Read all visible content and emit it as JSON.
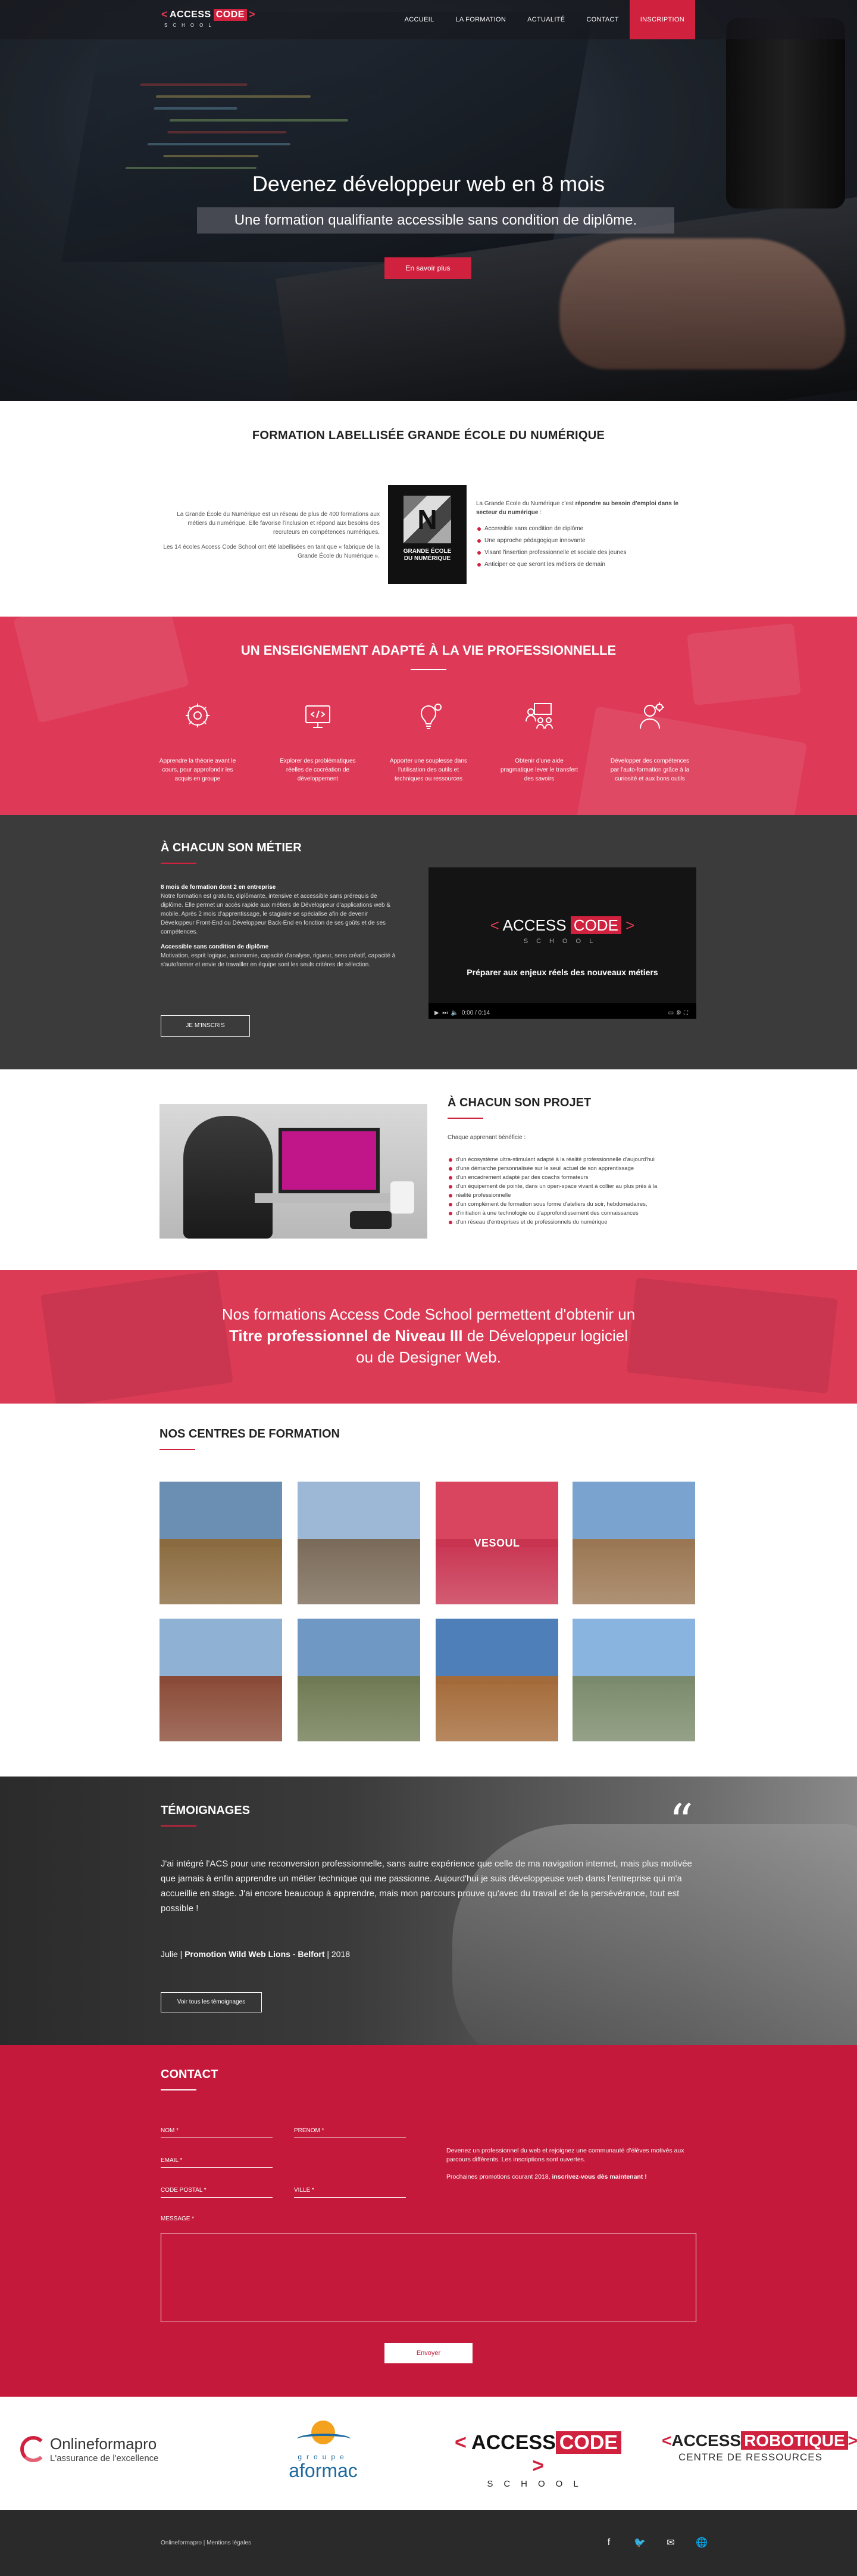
{
  "nav": {
    "logo_main": "ACCESS",
    "logo_code": "CODE",
    "logo_sub": "SCHOOL",
    "items": [
      {
        "label": "ACCUEIL"
      },
      {
        "label": "LA FORMATION"
      },
      {
        "label": "ACTUALITÉ"
      },
      {
        "label": "CONTACT"
      },
      {
        "label": "INSCRIPTION"
      }
    ]
  },
  "hero": {
    "title": "Devenez développeur web en 8 mois",
    "subtitle": "Une formation qualifiante accessible sans condition de diplôme.",
    "cta": "En savoir plus"
  },
  "label": {
    "title": "FORMATION LABELLISÉE GRANDE ÉCOLE DU NUMÉRIQUE",
    "left_p1": "La Grande École du Numérique est un réseau de plus de 400 formations aux métiers du numérique. Elle favorise l'inclusion et répond aux besoins des recruteurs en compétences numériques.",
    "left_p2": "Les 14 écoles Access Code School ont été labellisées en tant que « fabrique de la Grande École du Numérique ».",
    "logo_letter": "N",
    "logo_text_1": "GRANDE ÉCOLE",
    "logo_text_2": "DU NUMÉRIQUE",
    "right_intro_a": "La Grande École du Numérique c'est ",
    "right_intro_b": "répondre au besoin d'emploi dans le secteur du numérique",
    "right_intro_c": " :",
    "bullets": [
      "Accessible sans condition de diplôme",
      "Une approche pédagogique innovante",
      "Visant l'insertion professionnelle et sociale des jeunes",
      "Anticiper ce que seront les métiers de demain"
    ]
  },
  "enseignement": {
    "title": "UN ENSEIGNEMENT ADAPTÉ À LA VIE PROFESSIONNELLE",
    "items": [
      {
        "icon": "brain-gear-icon",
        "text": "Apprendre la théorie avant le cours, pour approfondir les acquis en groupe"
      },
      {
        "icon": "code-screen-icon",
        "text": "Explorer des problématiques réelles de cocréation de développement"
      },
      {
        "icon": "bulb-gear-icon",
        "text": "Apporter une souplesse dans l'utilisation des outils et techniques ou ressources"
      },
      {
        "icon": "team-board-icon",
        "text": "Obtenir d'une aide pragmatique lever le transfert des savoirs"
      },
      {
        "icon": "person-gear-icon",
        "text": "Développer des compétences par l'auto-formation grâce à la curiosité et aux bons outils"
      }
    ]
  },
  "metier": {
    "title": "À CHACUN SON MÉTIER",
    "p1_title": "8 mois de formation dont 2 en entreprise",
    "p1": "Notre formation est gratuite, diplômante, intensive et accessible sans prérequis de diplôme. Elle permet un accès rapide aux métiers de Développeur d'applications web & mobile. Après 2 mois d'apprentissage, le stagiaire se spécialise afin de devenir Développeur Front-End ou Développeur Back-End en fonction de ses goûts et de ses compétences.",
    "p2_title": "Accessible sans condition de diplôme",
    "p2": "Motivation, esprit logique, autonomie, capacité d'analyse, rigueur, sens créatif, capacité à s'autoformer et envie de travailler en équipe sont les seuls critères de sélection.",
    "button": "JE M'INSCRIS",
    "video": {
      "logo_main": "ACCESS",
      "logo_code": "CODE",
      "logo_sub": "SCHOOL",
      "title": "Préparer aux enjeux réels des nouveaux métiers",
      "time": "0:00 / 0:14",
      "progress": 0.04
    }
  },
  "projet": {
    "title": "À CHACUN SON PROJET",
    "intro": "Chaque apprenant bénéficie :",
    "bullets": [
      "d'un écosystème ultra-stimulant adapté à la réalité professionnelle d'aujourd'hui",
      "d'une démarche personnalisée sur le seuil actuel de son apprentissage",
      "d'un encadrement adapté par des coachs formateurs",
      "d'un équipement de pointe, dans un open-space vivant à collier au plus près à la",
      "réalité professionnelle",
      "d'un complément de formation sous forme d'ateliers du soir, hebdomadaires,",
      "d'initiation à une technologie ou d'approfondissement des connaissances",
      "d'un réseau d'entreprises et de professionnels du numérique"
    ]
  },
  "banner": {
    "line1": "Nos formations Access Code School permettent d'obtenir un",
    "line2_bold": "Titre professionnel de Niveau III",
    "line2_rest": " de Développeur logiciel",
    "line3": "ou de Designer Web."
  },
  "centres": {
    "title": "NOS CENTRES DE FORMATION",
    "tiles": [
      {
        "label": "",
        "sky": "#6b8fb3",
        "ground": "#8a6a3e"
      },
      {
        "label": "",
        "sky": "#9db8d6",
        "ground": "#7a6a58"
      },
      {
        "label": "VESOUL",
        "sky": "#d9455f",
        "ground": "#c83350"
      },
      {
        "label": "",
        "sky": "#7aa3cf",
        "ground": "#9a7652"
      },
      {
        "label": "",
        "sky": "#8fb2d4",
        "ground": "#8a4a36"
      },
      {
        "label": "",
        "sky": "#6f98c4",
        "ground": "#6f7a52"
      },
      {
        "label": "",
        "sky": "#4f7fb8",
        "ground": "#a46a38"
      },
      {
        "label": "",
        "sky": "#8ab4e0",
        "ground": "#7a8a6a"
      }
    ]
  },
  "temoignages": {
    "title": "TÉMOIGNAGES",
    "quote": "J'ai intégré l'ACS pour une reconversion professionnelle, sans autre expérience que celle de ma navigation internet, mais plus motivée que jamais à enfin apprendre un métier technique qui me passionne. Aujourd'hui je suis développeuse web dans l'entreprise qui m'a accueillie en stage. J'ai encore beaucoup à apprendre, mais mon parcours prouve qu'avec du travail et de la persévérance, tout est possible !",
    "author": "Julie",
    "promo": "Promotion Wild Web Lions - Belfort",
    "year": "2018",
    "button": "Voir tous les témoignages"
  },
  "contact": {
    "title": "CONTACT",
    "fields": {
      "nom": "NOM *",
      "prenom": "PRÉNOM *",
      "email": "EMAIL *",
      "cp": "CODE POSTAL *",
      "ville": "VILLE *"
    },
    "message_label": "MESSAGE *",
    "info_p1": "Devenez un professionnel du web et rejoignez une communauté d'élèves motivés aux parcours différents. Les inscriptions sont ouvertes.",
    "info_p2_a": "Prochaines promotions courant 2018, ",
    "info_p2_b": "inscrivez-vous dès maintenant !",
    "send": "Envoyer"
  },
  "partners": {
    "p1_name": "Onlineformapro",
    "p1_tag": "L'assurance de l'excellence",
    "p2_top": "groupe",
    "p2_name": "aformac",
    "p3_main": "ACCESS",
    "p3_code": "CODE",
    "p3_sub": "SCHOOL",
    "p4_main": "ACCESS",
    "p4_code": "ROBOTIQUE",
    "p4_sub": "CENTRE DE RESSOURCES"
  },
  "footer": {
    "link1": "Onlineformapro",
    "sep": " | ",
    "link2": "Mentions légales",
    "social": [
      "facebook-icon",
      "twitter-icon",
      "mail-icon",
      "globe-icon"
    ]
  },
  "colors": {
    "accent": "#d0223f",
    "dark": "#3b3b3b"
  }
}
